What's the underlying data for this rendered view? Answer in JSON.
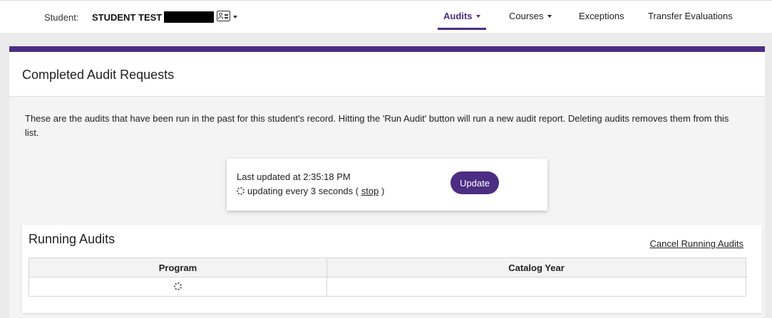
{
  "header": {
    "student_label": "Student:",
    "student_name": "STUDENT TEST /",
    "nav": {
      "audits": "Audits",
      "courses": "Courses",
      "exceptions": "Exceptions",
      "transfer": "Transfer Evaluations"
    }
  },
  "colors": {
    "brand_purple": "#4b2d83"
  },
  "card": {
    "title": "Completed Audit Requests",
    "description": "These are the audits that have been run in the past for this student's record. Hitting the 'Run Audit' button will run a new audit report. Deleting audits removes them from this list."
  },
  "updater": {
    "last_updated": "Last updated at 2:35:18 PM",
    "updating_text": "updating every 3 seconds (",
    "stop_label": "stop",
    "close_paren": ")",
    "update_button": "Update"
  },
  "running": {
    "title": "Running Audits",
    "cancel_link": "Cancel Running Audits",
    "columns": {
      "program": "Program",
      "catalog_year": "Catalog Year"
    }
  }
}
